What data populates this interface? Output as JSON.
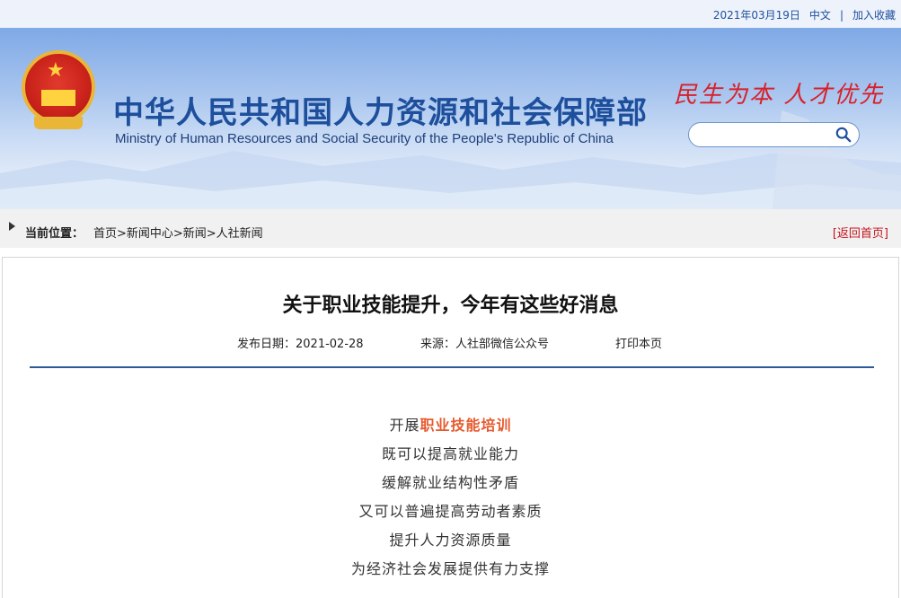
{
  "topbar": {
    "date": "2021年03月19日",
    "lang": "中文",
    "separator": "|",
    "bookmark": "加入收藏"
  },
  "header": {
    "title_cn": "中华人民共和国人力资源和社会保障部",
    "title_en": "Ministry of Human Resources and Social Security of the People's Republic of China",
    "slogan": "民生为本 人才优先",
    "search_placeholder": ""
  },
  "breadcrumb": {
    "label": "当前位置：",
    "path": "首页>新闻中心>新闻>人社新闻",
    "back": "[返回首页]"
  },
  "article": {
    "title": "关于职业技能提升，今年有这些好消息",
    "publish_date": "发布日期：2021-02-28",
    "source": "来源：人社部微信公众号",
    "print": "打印本页",
    "line1_prefix": "开展",
    "line1_highlight": "职业技能培训",
    "lines": [
      "既可以提高就业能力",
      "缓解就业结构性矛盾",
      "又可以普遍提高劳动者素质",
      "提升人力资源质量",
      "为经济社会发展提供有力支撑"
    ]
  },
  "colors": {
    "brand_blue": "#1d4f9c",
    "accent_red": "#d8202a",
    "highlight_orange": "#e65a2e",
    "rule_blue": "#2b5a97"
  }
}
